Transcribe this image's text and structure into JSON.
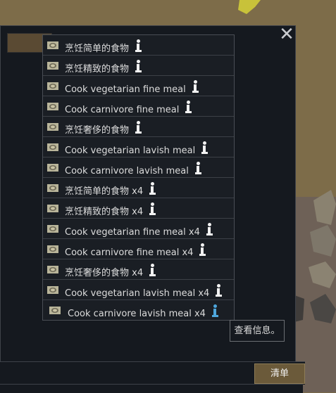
{
  "dialog": {
    "close_glyph": "✕",
    "bills_button_label": "清单",
    "tooltip_text": "查看信息。"
  },
  "menu": {
    "items": [
      {
        "label": "烹饪简单的食物",
        "icon": "simple-meal-icon"
      },
      {
        "label": "烹饪精致的食物",
        "icon": "fine-meal-icon"
      },
      {
        "label": "Cook vegetarian fine meal",
        "icon": "vegetarian-fine-meal-icon"
      },
      {
        "label": "Cook carnivore fine meal",
        "icon": "carnivore-fine-meal-icon"
      },
      {
        "label": "烹饪奢侈的食物",
        "icon": "lavish-meal-icon"
      },
      {
        "label": "Cook vegetarian lavish meal",
        "icon": "vegetarian-lavish-meal-icon"
      },
      {
        "label": "Cook carnivore lavish meal",
        "icon": "carnivore-lavish-meal-icon"
      },
      {
        "label": "烹饪简单的食物 x4",
        "icon": "simple-meal-icon"
      },
      {
        "label": "烹饪精致的食物 x4",
        "icon": "fine-meal-icon"
      },
      {
        "label": "Cook vegetarian fine meal x4",
        "icon": "vegetarian-fine-meal-icon"
      },
      {
        "label": "Cook carnivore fine meal x4",
        "icon": "carnivore-fine-meal-icon"
      },
      {
        "label": "烹饪奢侈的食物 x4",
        "icon": "lavish-meal-icon"
      },
      {
        "label": "Cook vegetarian lavish meal x4",
        "icon": "vegetarian-lavish-meal-icon"
      },
      {
        "label": "Cook carnivore lavish meal x4",
        "icon": "carnivore-lavish-meal-icon"
      }
    ],
    "highlighted_index": 13
  },
  "colors": {
    "panel": "#15191f",
    "info_highlight": "#4ea6dc",
    "button": "#6b5a3a"
  }
}
